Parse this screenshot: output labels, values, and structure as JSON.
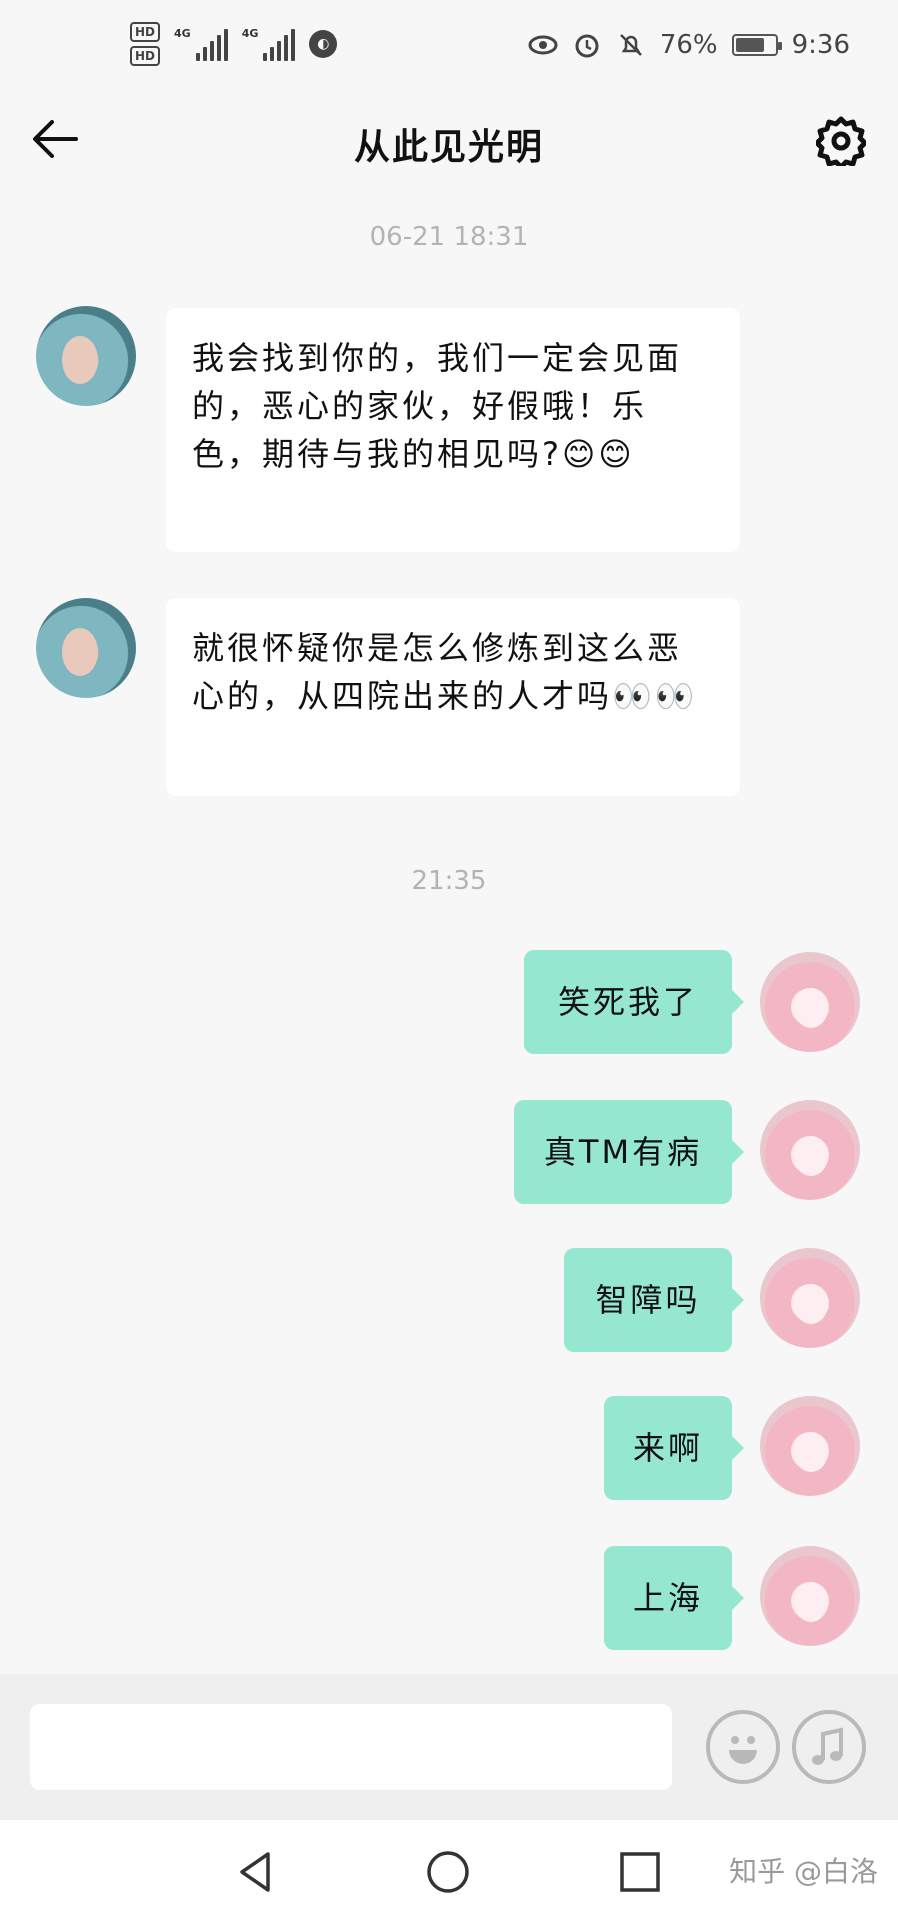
{
  "status_bar": {
    "hd1": "HD",
    "hd2": "HD",
    "net1": "4G",
    "net2": "4G",
    "battery_percent": "76%",
    "battery_level": 0.76,
    "time": "9:36",
    "icons": [
      "eye-icon",
      "alarm-icon",
      "mute-bell-icon",
      "battery-icon",
      "globe-icon"
    ]
  },
  "header": {
    "title": "从此见光明",
    "back_icon": "arrow-left-icon",
    "settings_icon": "gear-icon"
  },
  "messages": {
    "stamp1": "06-21 18:31",
    "incoming": [
      {
        "text": "我会找到你的，我们一定会见面的，恶心的家伙，好假哦！乐色，期待与我的相见吗?😊😊"
      },
      {
        "text": "就很怀疑你是怎么修炼到这么恶心的，从四院出来的人才吗👀👀"
      }
    ],
    "stamp2": "21:35",
    "outgoing": [
      {
        "text": "笑死我了"
      },
      {
        "text": "真TM有病"
      },
      {
        "text": "智障吗"
      },
      {
        "text": "来啊"
      },
      {
        "text": "上海"
      }
    ]
  },
  "input": {
    "value": "",
    "placeholder": "",
    "emoji_icon": "smiley-icon",
    "voice_icon": "music-note-icon"
  },
  "navbar": {
    "back_icon": "triangle-back-icon",
    "home_icon": "circle-home-icon",
    "recent_icon": "square-recent-icon",
    "watermark": "知乎 @白洛"
  },
  "colors": {
    "background": "#f7f7f7",
    "incoming_bubble": "#ffffff",
    "outgoing_bubble": "#95e8cf",
    "timestamp": "#b3b3b3"
  }
}
